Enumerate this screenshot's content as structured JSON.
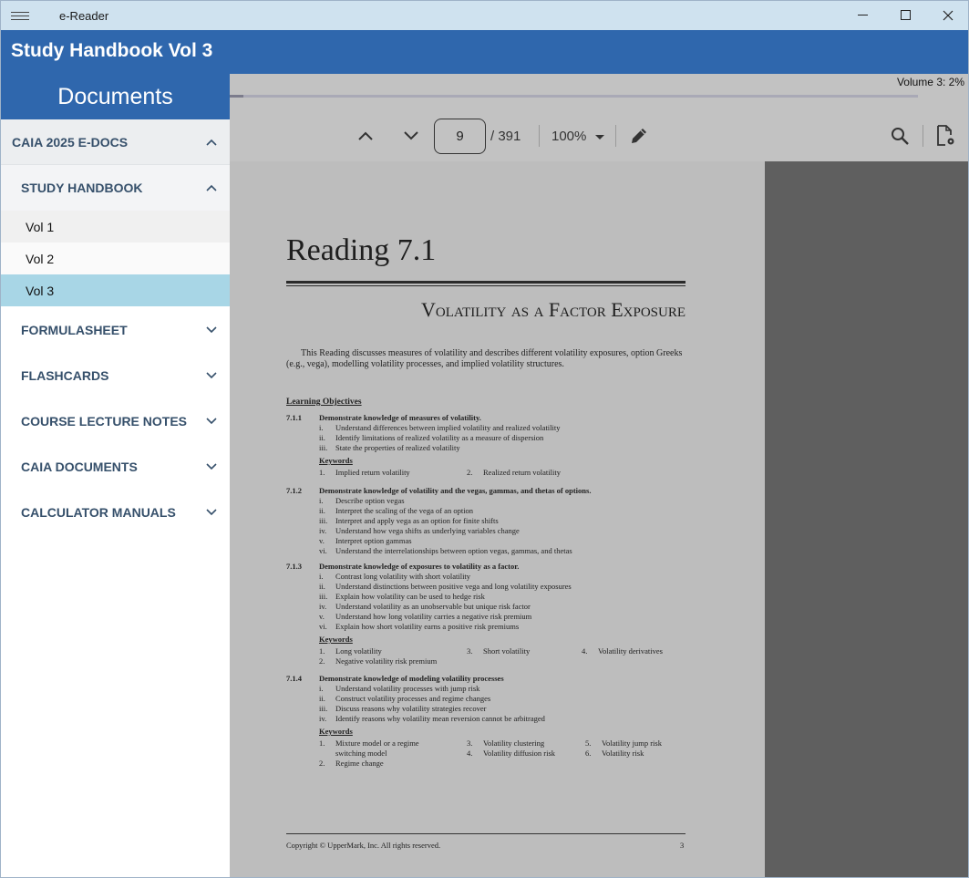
{
  "window": {
    "title": "e-Reader"
  },
  "header": {
    "title": "Study Handbook Vol 3"
  },
  "sidebar": {
    "heading": "Documents",
    "group": "CAIA 2025 E-DOCS",
    "subgroup": "STUDY HANDBOOK",
    "volumes": [
      "Vol 1",
      "Vol 2",
      "Vol 3"
    ],
    "categories": [
      "FORMULASHEET",
      "FLASHCARDS",
      "COURSE LECTURE NOTES",
      "CAIA DOCUMENTS",
      "CALCULATOR MANUALS"
    ]
  },
  "viewer": {
    "progress_label": "Volume 3: 2%",
    "progress_fraction": 0.02,
    "page_number": "9",
    "page_total": "/ 391",
    "zoom": "100%"
  },
  "page": {
    "reading": "Reading 7.1",
    "subtitle": "Volatility as a Factor Exposure",
    "intro": "This Reading discusses measures of volatility and describes different volatility exposures, option Greeks (e.g., vega), modelling volatility processes, and implied volatility structures.",
    "lo_heading": "Learning Objectives",
    "obj1": {
      "num": "7.1.1",
      "head": "Demonstrate knowledge of measures of volatility.",
      "items": [
        [
          "i.",
          "Understand differences between implied volatility and realized volatility"
        ],
        [
          "ii.",
          "Identify limitations of realized volatility as a measure of dispersion"
        ],
        [
          "iii.",
          "State the properties of realized volatility"
        ]
      ],
      "kw_label": "Keywords",
      "kw": [
        "1.",
        "Implied return volatility",
        "2.",
        "Realized return volatility"
      ]
    },
    "obj2": {
      "num": "7.1.2",
      "head": "Demonstrate knowledge of volatility and the vegas, gammas, and thetas of options.",
      "items": [
        [
          "i.",
          "Describe option vegas"
        ],
        [
          "ii.",
          "Interpret the scaling of the vega of an option"
        ],
        [
          "iii.",
          "Interpret and apply vega as an option for finite shifts"
        ],
        [
          "iv.",
          "Understand how vega shifts as underlying variables change"
        ],
        [
          "v.",
          "Interpret option gammas"
        ],
        [
          "vi.",
          "Understand the interrelationships between option vegas, gammas, and thetas"
        ]
      ]
    },
    "obj3": {
      "num": "7.1.3",
      "head": "Demonstrate knowledge of exposures to volatility as a factor.",
      "items": [
        [
          "i.",
          "Contrast long volatility with short volatility"
        ],
        [
          "ii.",
          "Understand distinctions between positive vega and long volatility exposures"
        ],
        [
          "iii.",
          "Explain how volatility can be used to hedge risk"
        ],
        [
          "iv.",
          "Understand volatility as an unobservable but unique risk factor"
        ],
        [
          "v.",
          "Understand how long volatility carries a negative risk premium"
        ],
        [
          "vi.",
          "Explain how short volatility earns a positive risk premiums"
        ]
      ],
      "kw_label": "Keywords",
      "kw_row1": [
        "1.",
        "Long volatility",
        "3.",
        "Short volatility",
        "4.",
        "Volatility derivatives"
      ],
      "kw_row2": [
        "2.",
        "Negative volatility risk premium"
      ]
    },
    "obj4": {
      "num": "7.1.4",
      "head": "Demonstrate knowledge of modeling volatility processes",
      "items": [
        [
          "i.",
          "Understand volatility processes with jump risk"
        ],
        [
          "ii.",
          "Construct volatility processes and regime changes"
        ],
        [
          "iii.",
          "Discuss reasons why volatility strategies recover"
        ],
        [
          "iv.",
          "Identify reasons why volatility mean reversion cannot be arbitraged"
        ]
      ],
      "kw_label": "Keywords",
      "kw_row1": [
        "1.",
        "Mixture model or a regime",
        "3.",
        "Volatility clustering",
        "5.",
        "Volatility jump risk"
      ],
      "kw_row2": [
        "",
        "switching model",
        "4.",
        "Volatility diffusion risk",
        "6.",
        "Volatility risk"
      ],
      "kw_row3": [
        "2.",
        "Regime change"
      ]
    },
    "footer": "Copyright © UpperMark, Inc. All rights reserved.",
    "footer_page": "3"
  }
}
